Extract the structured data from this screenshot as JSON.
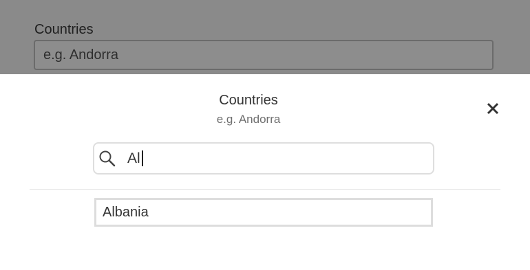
{
  "background_form": {
    "label": "Countries",
    "placeholder": "e.g. Andorra"
  },
  "modal": {
    "title": "Countries",
    "subtitle": "e.g. Andorra",
    "close_icon": "close-icon",
    "search": {
      "icon": "search-icon",
      "value": "Al"
    },
    "results": [
      {
        "label": "Albania"
      }
    ]
  },
  "colors": {
    "overlay": "#8a8a8a",
    "text_primary": "#333333",
    "text_secondary": "#6f6f6f",
    "border": "#dddddd"
  }
}
